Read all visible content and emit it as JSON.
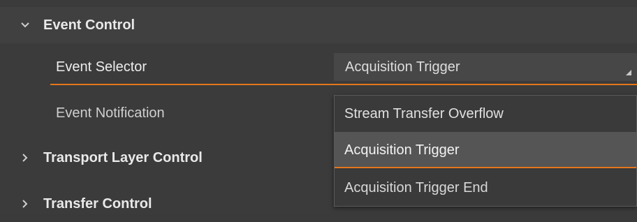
{
  "sections": {
    "event_control": {
      "title": "Event Control",
      "expanded": true
    },
    "transport_layer_control": {
      "title": "Transport Layer Control",
      "expanded": false
    },
    "transfer_control": {
      "title": "Transfer Control",
      "expanded": false
    }
  },
  "icons": {
    "expanded": "chevron-down-icon",
    "collapsed": "chevron-right-icon"
  },
  "properties": {
    "event_selector": {
      "label": "Event Selector",
      "value": "Acquisition Trigger"
    },
    "event_notification": {
      "label": "Event Notification"
    }
  },
  "dropdown": {
    "options": [
      "Stream Transfer Overflow",
      "Acquisition Trigger",
      "Acquisition Trigger End"
    ],
    "selected_option": "Acquisition Trigger"
  },
  "colors": {
    "accent": "#e3761c",
    "background": "#3b3b3b",
    "selected_item": "#555555"
  }
}
